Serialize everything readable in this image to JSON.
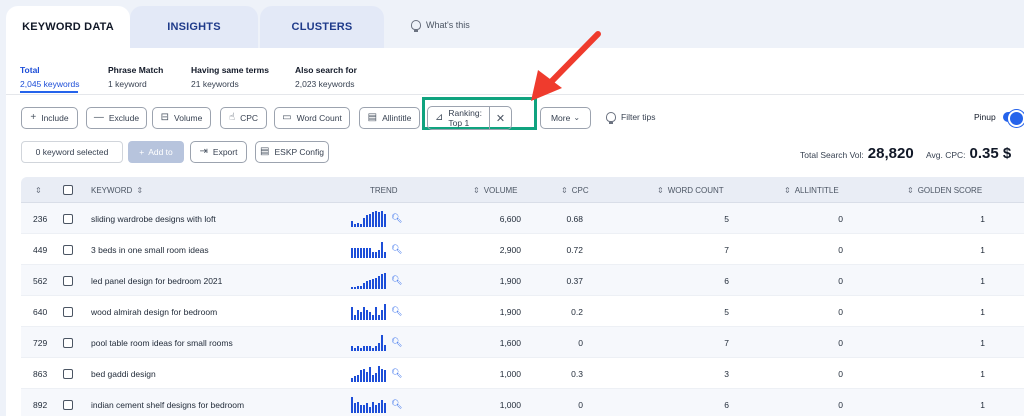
{
  "tabs": [
    {
      "label": "KEYWORD DATA"
    },
    {
      "label": "INSIGHTS"
    },
    {
      "label": "CLUSTERS"
    }
  ],
  "whats_this": "What's this",
  "stats": [
    {
      "label": "Total",
      "sub": "2,045 keywords"
    },
    {
      "label": "Phrase Match",
      "sub": "1 keyword"
    },
    {
      "label": "Having same terms",
      "sub": "21 keywords"
    },
    {
      "label": "Also search for",
      "sub": "2,023 keywords"
    }
  ],
  "filters": {
    "include": "Include",
    "exclude": "Exclude",
    "volume": "Volume",
    "cpc": "CPC",
    "word_count": "Word Count",
    "allintitle": "Allintitle",
    "ranking": "Ranking: Top 1",
    "more": "More",
    "filter_tips": "Filter tips",
    "pinup": "Pinup"
  },
  "actions": {
    "selected": "0 keyword selected",
    "add_to": "Add to",
    "export": "Export",
    "eskp": "ESKP Config"
  },
  "totals": {
    "search_vol_label": "Total Search Vol:",
    "search_vol": "28,820",
    "cpc_label": "Avg. CPC:",
    "cpc": "0.35 $"
  },
  "columns": {
    "keyword": "KEYWORD",
    "trend": "TREND",
    "volume": "VOLUME",
    "cpc": "CPC",
    "word_count": "WORD COUNT",
    "allintitle": "ALLINTITLE",
    "golden": "GOLDEN SCORE"
  },
  "rows": [
    {
      "id": "236",
      "keyword": "sliding wardrobe designs with loft",
      "volume": "6,600",
      "cpc": "0.68",
      "word_count": "5",
      "allintitle": "0",
      "golden": "1",
      "trend": [
        4,
        2,
        3,
        2,
        6,
        8,
        9,
        10,
        11,
        10,
        11,
        9
      ]
    },
    {
      "id": "449",
      "keyword": "3 beds in one small room ideas",
      "volume": "2,900",
      "cpc": "0.72",
      "word_count": "7",
      "allintitle": "0",
      "golden": "1",
      "trend": [
        6,
        6,
        6,
        6,
        6,
        6,
        6,
        4,
        4,
        5,
        10,
        4
      ]
    },
    {
      "id": "562",
      "keyword": "led panel design for bedroom 2021",
      "volume": "1,900",
      "cpc": "0.37",
      "word_count": "6",
      "allintitle": "0",
      "golden": "1",
      "trend": [
        2,
        2,
        3,
        3,
        5,
        7,
        8,
        9,
        10,
        11,
        13,
        14
      ]
    },
    {
      "id": "640",
      "keyword": "wood almirah design for bedroom",
      "volume": "1,900",
      "cpc": "0.2",
      "word_count": "5",
      "allintitle": "0",
      "golden": "1",
      "trend": [
        8,
        3,
        6,
        5,
        8,
        6,
        5,
        3,
        8,
        3,
        6,
        10
      ]
    },
    {
      "id": "729",
      "keyword": "pool table room ideas for small rooms",
      "volume": "1,600",
      "cpc": "0",
      "word_count": "7",
      "allintitle": "0",
      "golden": "1",
      "trend": [
        3,
        2,
        3,
        2,
        3,
        3,
        3,
        2,
        3,
        5,
        10,
        4
      ]
    },
    {
      "id": "863",
      "keyword": "bed gaddi design",
      "volume": "1,000",
      "cpc": "0.3",
      "word_count": "3",
      "allintitle": "0",
      "golden": "1",
      "trend": [
        3,
        4,
        5,
        8,
        9,
        7,
        10,
        5,
        6,
        11,
        9,
        8
      ]
    },
    {
      "id": "892",
      "keyword": "indian cement shelf designs for bedroom",
      "volume": "1,000",
      "cpc": "0",
      "word_count": "6",
      "allintitle": "0",
      "golden": "1",
      "trend": [
        10,
        6,
        7,
        5,
        5,
        6,
        4,
        7,
        5,
        6,
        8,
        6
      ]
    }
  ]
}
